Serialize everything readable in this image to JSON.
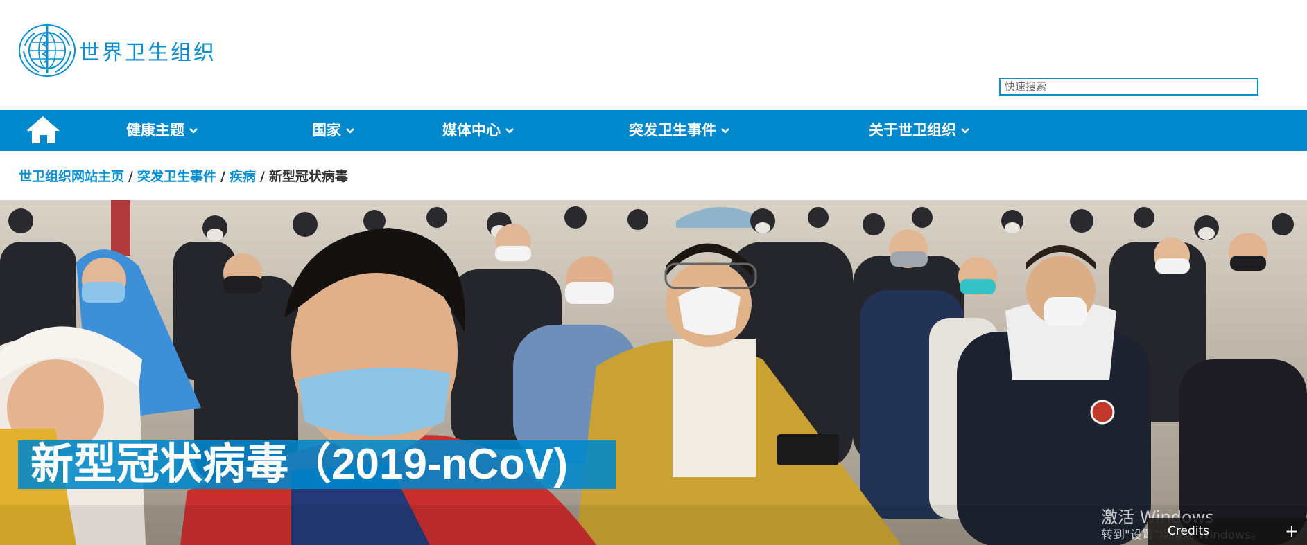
{
  "header": {
    "logo_text": "世界卫生组织",
    "search_placeholder": "快速搜索"
  },
  "nav": {
    "items": [
      {
        "label": "健康主题"
      },
      {
        "label": "国家"
      },
      {
        "label": "媒体中心"
      },
      {
        "label": "突发卫生事件"
      },
      {
        "label": "关于世卫组织"
      }
    ]
  },
  "breadcrumb": {
    "items": [
      "世卫组织网站主页",
      "突发卫生事件",
      "疾病"
    ],
    "current": "新型冠状病毒",
    "separator": "/"
  },
  "hero": {
    "title": "新型冠状病毒（2019-nCoV)"
  },
  "overlay": {
    "activate_title": "激活 Windows",
    "activate_sub": "转到\"设置\"以激活 Windows。",
    "credits_label": "Credits",
    "credits_plus": "+"
  },
  "colors": {
    "brand": "#0088cc",
    "link": "#0a8fd0"
  }
}
